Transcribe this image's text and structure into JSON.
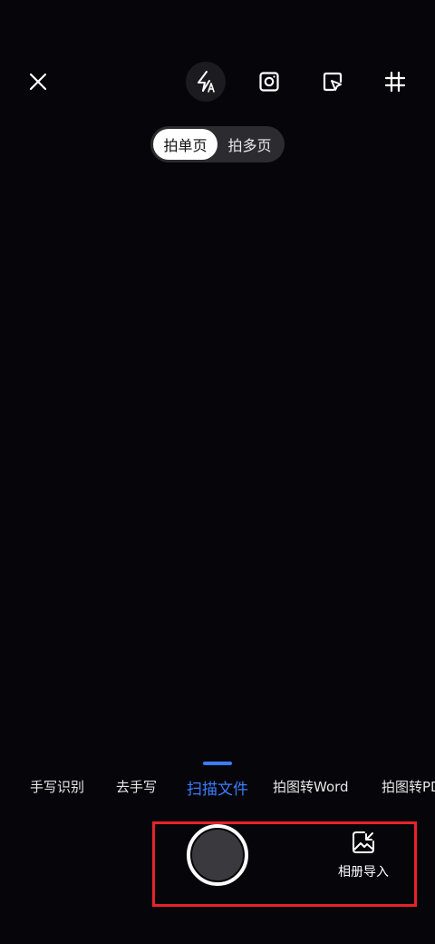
{
  "top_bar": {
    "close_icon": "close-icon",
    "flash_icon": "flash-auto-icon",
    "camera_icon": "camera-icon",
    "crop_icon": "crop-select-icon",
    "grid_icon": "grid-icon"
  },
  "mode_toggle": {
    "single_label": "拍单页",
    "multi_label": "拍多页",
    "selected": "single"
  },
  "tabs": {
    "items": [
      {
        "label": "手写识别"
      },
      {
        "label": "去手写"
      },
      {
        "label": "扫描文件"
      },
      {
        "label": "拍图转Word"
      },
      {
        "label": "拍图转PDF"
      }
    ],
    "active_index": 2
  },
  "bottom": {
    "album_import_label": "相册导入"
  },
  "colors": {
    "accent": "#3b7cff",
    "highlight_border": "#e8222b",
    "background": "#06060a"
  }
}
